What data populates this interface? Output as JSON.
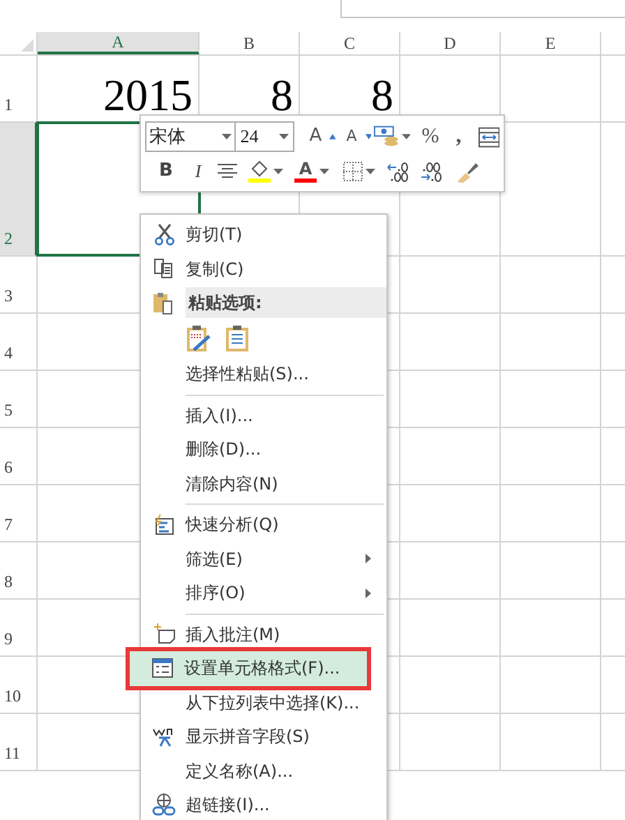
{
  "columns": [
    {
      "label": "A",
      "selected": true
    },
    {
      "label": "B",
      "selected": false
    },
    {
      "label": "C",
      "selected": false
    },
    {
      "label": "D",
      "selected": false
    },
    {
      "label": "E",
      "selected": false
    }
  ],
  "rows": [
    {
      "label": "1",
      "selected": false,
      "values": [
        "2015",
        "8",
        "8"
      ]
    },
    {
      "label": "2",
      "selected": true
    },
    {
      "label": "3",
      "selected": false
    },
    {
      "label": "4",
      "selected": false
    },
    {
      "label": "5",
      "selected": false
    },
    {
      "label": "6",
      "selected": false
    },
    {
      "label": "7",
      "selected": false
    },
    {
      "label": "8",
      "selected": false
    },
    {
      "label": "9",
      "selected": false
    },
    {
      "label": "10",
      "selected": false
    },
    {
      "label": "11",
      "selected": false
    }
  ],
  "mini_toolbar": {
    "font": "宋体",
    "size": "24",
    "grow_label": "A",
    "shrink_label": "A",
    "percent": "%",
    "comma": ",",
    "bold": "B",
    "italic": "I",
    "font_color_label": "A"
  },
  "menu": [
    {
      "kind": "item",
      "label": "剪切(T)",
      "selected": false,
      "submenu": false,
      "outlined": false
    },
    {
      "kind": "item",
      "label": "复制(C)",
      "selected": false,
      "submenu": false,
      "outlined": false
    },
    {
      "kind": "header",
      "label": "粘贴选项:"
    },
    {
      "kind": "paste-icons"
    },
    {
      "kind": "item",
      "label": "选择性粘贴(S)...",
      "selected": false,
      "submenu": false,
      "outlined": false
    },
    {
      "kind": "separator"
    },
    {
      "kind": "item",
      "label": "插入(I)...",
      "selected": false,
      "submenu": false,
      "outlined": false
    },
    {
      "kind": "item",
      "label": "删除(D)...",
      "selected": false,
      "submenu": false,
      "outlined": false
    },
    {
      "kind": "item",
      "label": "清除内容(N)",
      "selected": false,
      "submenu": false,
      "outlined": false
    },
    {
      "kind": "separator"
    },
    {
      "kind": "item",
      "label": "快速分析(Q)",
      "selected": false,
      "submenu": false,
      "outlined": false
    },
    {
      "kind": "item",
      "label": "筛选(E)",
      "selected": false,
      "submenu": true,
      "outlined": false
    },
    {
      "kind": "item",
      "label": "排序(O)",
      "selected": false,
      "submenu": true,
      "outlined": false
    },
    {
      "kind": "separator"
    },
    {
      "kind": "item",
      "label": "插入批注(M)",
      "selected": false,
      "submenu": false,
      "outlined": false
    },
    {
      "kind": "item",
      "label": "设置单元格格式(F)...",
      "selected": true,
      "submenu": false,
      "outlined": true
    },
    {
      "kind": "item",
      "label": "从下拉列表中选择(K)...",
      "selected": false,
      "submenu": false,
      "outlined": false
    },
    {
      "kind": "item",
      "label": "显示拼音字段(S)",
      "selected": false,
      "submenu": false,
      "outlined": false
    },
    {
      "kind": "item",
      "label": "定义名称(A)...",
      "selected": false,
      "submenu": false,
      "outlined": false
    },
    {
      "kind": "item",
      "label": "超链接(I)...",
      "selected": false,
      "submenu": false,
      "outlined": false
    }
  ]
}
